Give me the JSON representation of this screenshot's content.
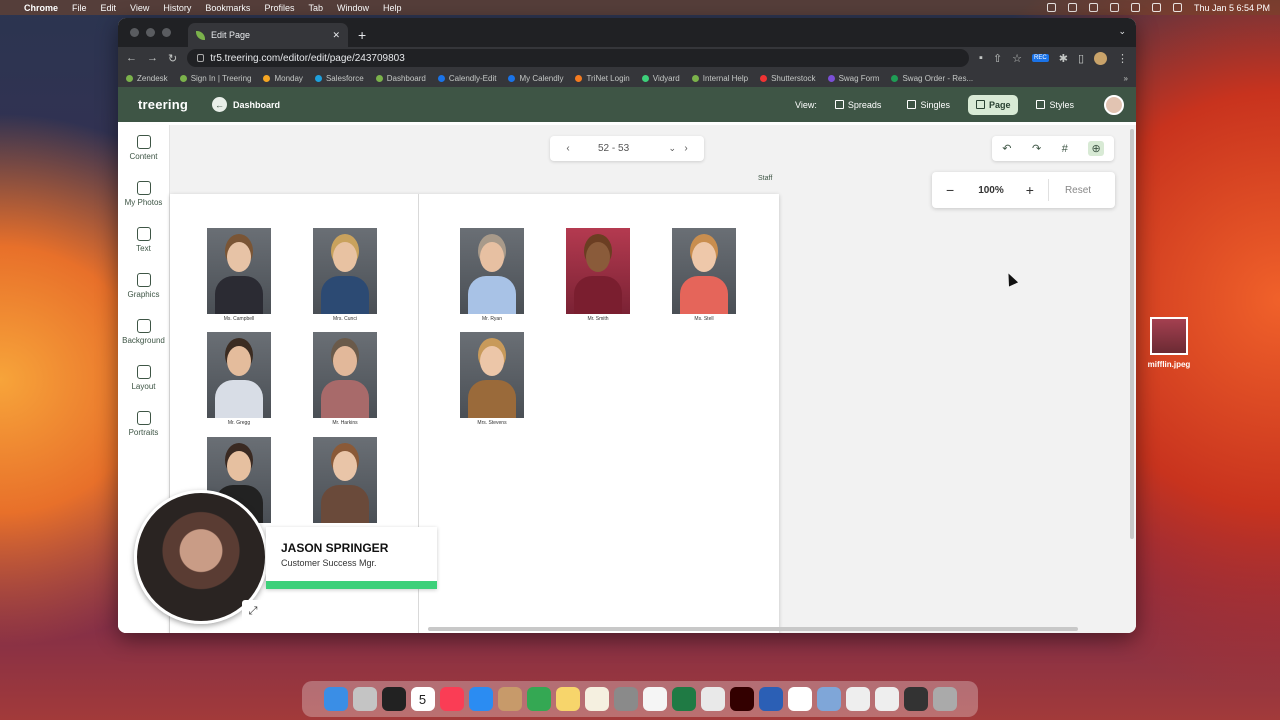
{
  "menubar": {
    "app": "Chrome",
    "items": [
      "File",
      "Edit",
      "View",
      "History",
      "Bookmarks",
      "Profiles",
      "Tab",
      "Window",
      "Help"
    ],
    "clock": "Thu Jan 5  6:54 PM"
  },
  "browser": {
    "tab_title": "Edit Page",
    "url": "tr5.treering.com/editor/edit/page/243709803",
    "rec_badge": "REC",
    "bookmarks": [
      {
        "label": "Zendesk",
        "color": "#7bb24b"
      },
      {
        "label": "Sign In | Treering",
        "color": "#7bb24b"
      },
      {
        "label": "Monday",
        "color": "#f5a623"
      },
      {
        "label": "Salesforce",
        "color": "#1ea0dc"
      },
      {
        "label": "Dashboard",
        "color": "#7bb24b"
      },
      {
        "label": "Calendly-Edit",
        "color": "#1a73e8"
      },
      {
        "label": "My Calendly",
        "color": "#1a73e8"
      },
      {
        "label": "TriNet Login",
        "color": "#f47b20"
      },
      {
        "label": "Vidyard",
        "color": "#3dd07a"
      },
      {
        "label": "Internal Help",
        "color": "#7bb24b"
      },
      {
        "label": "Shutterstock",
        "color": "#e33"
      },
      {
        "label": "Swag Form",
        "color": "#7b4fd6"
      },
      {
        "label": "Swag Order - Res...",
        "color": "#1f9d55"
      }
    ]
  },
  "app": {
    "logo": "treering",
    "back_label": "Dashboard",
    "view_label": "View:",
    "views": [
      {
        "label": "Spreads",
        "active": false
      },
      {
        "label": "Singles",
        "active": false
      },
      {
        "label": "Page",
        "active": true
      },
      {
        "label": "Styles",
        "active": false
      }
    ]
  },
  "sidebar": {
    "items": [
      "Content",
      "My Photos",
      "Text",
      "Graphics",
      "Background",
      "Layout",
      "Portraits"
    ]
  },
  "pager": {
    "value": "52 - 53"
  },
  "zoom": {
    "value": "100%",
    "reset_label": "Reset"
  },
  "canvas": {
    "section_label": "Staff",
    "portraits": [
      {
        "name": "Ms. Campbell",
        "skin": "#e7c3a6",
        "hair": "#7a5535",
        "shirt": "#2b2b33"
      },
      {
        "name": "Mrs. Cunci",
        "skin": "#e8c2a2",
        "hair": "#c9a25d",
        "shirt": "#2c4a73"
      },
      {
        "name": "Mr. Ryan",
        "skin": "#e7c0a2",
        "hair": "#a89a8a",
        "shirt": "#a8c2e6"
      },
      {
        "name": "Mr. Smith",
        "skin": "#8a5b3a",
        "hair": "#6b3e22",
        "shirt": "#7a1e2f"
      },
      {
        "name": "Ms. Stell",
        "skin": "#eec8aa",
        "hair": "#c98e4f",
        "shirt": "#e5655a"
      },
      {
        "name": "Mr. Gregg",
        "skin": "#e4bc9c",
        "hair": "#3b2c22",
        "shirt": "#d8dde6"
      },
      {
        "name": "Mr. Harkins",
        "skin": "#e2b89a",
        "hair": "#6a5a4a",
        "shirt": "#a86a6a"
      },
      {
        "name": "Mrs. Stevens",
        "skin": "#ecc6a8",
        "hair": "#c89a5a",
        "shirt": "#9a6a3a"
      },
      {
        "name": "",
        "skin": "#e6c0a0",
        "hair": "#3a2a22",
        "shirt": "#222"
      },
      {
        "name": "",
        "skin": "#e9c5a8",
        "hair": "#8a5a38",
        "shirt": "#6a4a3a"
      }
    ]
  },
  "presenter": {
    "name": "JASON SPRINGER",
    "role": "Customer Success Mgr."
  },
  "desktop_file": {
    "label": "mifflin.jpeg"
  },
  "dock": {
    "calendar_day": "5",
    "icons": [
      {
        "name": "finder-icon",
        "color": "#3a8ee6"
      },
      {
        "name": "launchpad-icon",
        "color": "#c4c4c4"
      },
      {
        "name": "mission-control-icon",
        "color": "#222"
      },
      {
        "name": "calendar-icon",
        "color": "#fff"
      },
      {
        "name": "music-icon",
        "color": "#fa3d55"
      },
      {
        "name": "app-store-icon",
        "color": "#2b8cf2"
      },
      {
        "name": "contacts-icon",
        "color": "#c79a6a"
      },
      {
        "name": "maps-icon",
        "color": "#34a853"
      },
      {
        "name": "notes-icon",
        "color": "#f7d56b"
      },
      {
        "name": "stickies-icon",
        "color": "#f5f0e0"
      },
      {
        "name": "settings-icon",
        "color": "#8a8a8a"
      },
      {
        "name": "clock-icon",
        "color": "#f5f5f5"
      },
      {
        "name": "excel-icon",
        "color": "#1f7a44"
      },
      {
        "name": "chrome-icon",
        "color": "#e9e9e9"
      },
      {
        "name": "illustrator-icon",
        "color": "#330000"
      },
      {
        "name": "word-icon",
        "color": "#2b5fb5"
      },
      {
        "name": "slack-icon",
        "color": "#fff"
      },
      {
        "name": "preview-icon",
        "color": "#7fa6d8"
      },
      {
        "name": "window-thumb-1-icon",
        "color": "#eee"
      },
      {
        "name": "window-thumb-2-icon",
        "color": "#eee"
      },
      {
        "name": "window-thumb-3-icon",
        "color": "#333"
      },
      {
        "name": "trash-icon",
        "color": "#aaa"
      }
    ]
  }
}
